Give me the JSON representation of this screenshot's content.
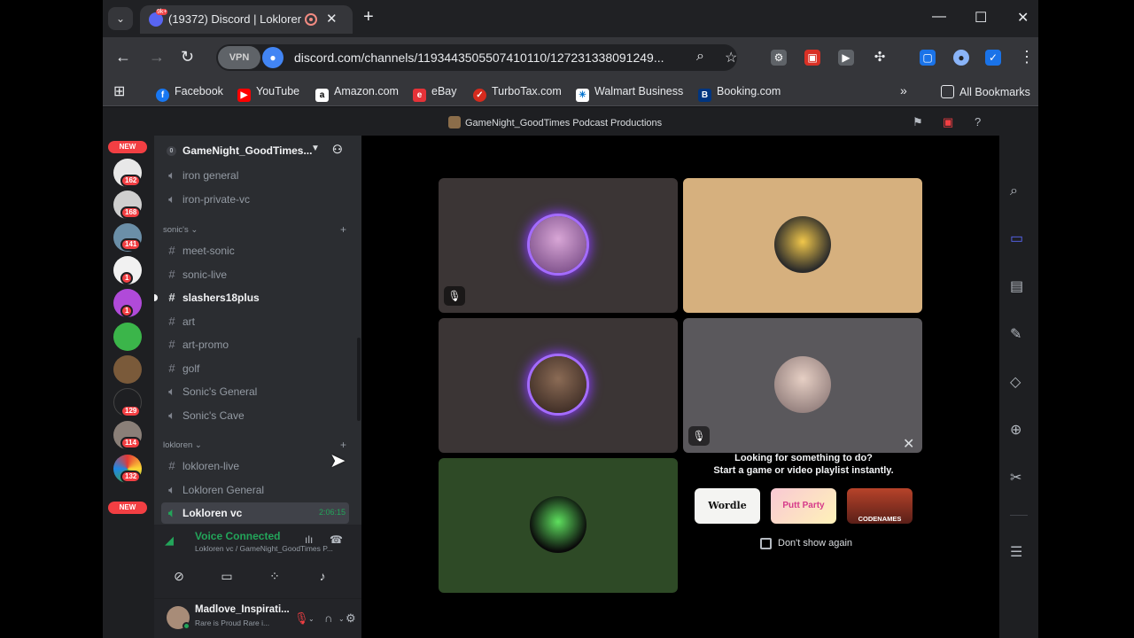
{
  "browser": {
    "tab_title": "(19372) Discord | Lokloren v",
    "tab_badge": "9k+",
    "url": "discord.com/channels/1193443505507410110/127231338091249...",
    "vpn_label": "VPN",
    "bookmarks": [
      {
        "label": "Facebook",
        "icon": "facebook-icon",
        "color": "#1877f2"
      },
      {
        "label": "YouTube",
        "icon": "youtube-icon",
        "color": "#ff0000"
      },
      {
        "label": "Amazon.com",
        "icon": "amazon-icon",
        "color": "#ffffff"
      },
      {
        "label": "eBay",
        "icon": "ebay-icon",
        "color": "#e53238"
      },
      {
        "label": "TurboTax.com",
        "icon": "turbotax-icon",
        "color": "#d52b1e"
      },
      {
        "label": "Walmart Business",
        "icon": "walmart-icon",
        "color": "#ffffff"
      },
      {
        "label": "Booking.com",
        "icon": "booking-icon",
        "color": "#003580"
      }
    ],
    "all_bookmarks": "All Bookmarks"
  },
  "app": {
    "window_title": "GameNight_GoodTimes Podcast Productions",
    "server_name": "GameNight_GoodTimes...",
    "guilds": {
      "new_top": "NEW",
      "new_bottom": "NEW",
      "badges": [
        "162",
        "168",
        "141",
        "1",
        "1",
        "129",
        "114",
        "132"
      ]
    },
    "channels": [
      {
        "label": "iron general",
        "type": "voice"
      },
      {
        "label": "iron-private-vc",
        "type": "voice"
      }
    ],
    "category_sonic": "sonic's",
    "sonic_channels": [
      {
        "label": "meet-sonic",
        "type": "text"
      },
      {
        "label": "sonic-live",
        "type": "voice"
      },
      {
        "label": "slashers18plus",
        "type": "text"
      },
      {
        "label": "art",
        "type": "text"
      },
      {
        "label": "art-promo",
        "type": "text"
      },
      {
        "label": "golf",
        "type": "text"
      },
      {
        "label": "Sonic's General",
        "type": "voice"
      },
      {
        "label": "Sonic's Cave",
        "type": "voice"
      }
    ],
    "category_lokloren": "lokloren",
    "lokloren_channels": [
      {
        "label": "lokloren-live",
        "type": "text"
      },
      {
        "label": "Lokloren General",
        "type": "voice"
      },
      {
        "label": "Lokloren vc",
        "type": "voice",
        "timer": "2:06:15"
      }
    ],
    "voice": {
      "status": "Voice Connected",
      "subtitle": "Lokloren vc / GameNight_GoodTimes P..."
    },
    "user": {
      "name": "Madlove_Inspirati...",
      "status": "Rare is Proud Rare i..."
    },
    "activity": {
      "heading1": "Looking for something to do?",
      "heading2": "Start a game or video playlist instantly.",
      "games": [
        "Wordle",
        "Putt Party",
        "CODENAMES ONLINE"
      ],
      "dont_show": "Don't show again"
    },
    "colors": {
      "accent": "#5865f2",
      "voice_green": "#23a55a",
      "danger": "#f23f43"
    }
  }
}
